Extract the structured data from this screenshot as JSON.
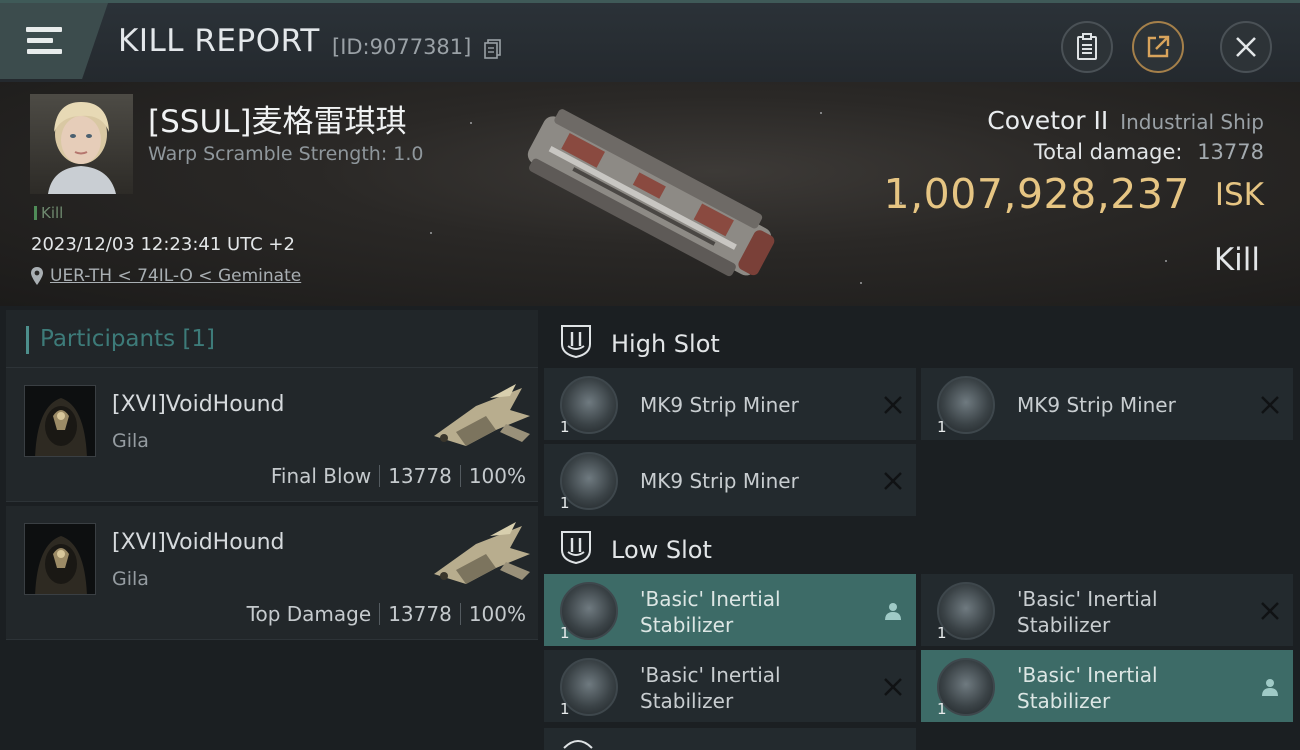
{
  "header": {
    "title": "KILL REPORT",
    "report_id": "[ID:9077381]",
    "icons": {
      "menu": "menu-icon",
      "copy": "copy-icon",
      "clipboard": "clipboard-icon",
      "share": "share-icon",
      "close": "close-icon"
    }
  },
  "victim": {
    "pilot_name": "[SSUL]麦格雷琪琪",
    "warp_scramble": "Warp Scramble Strength: 1.0",
    "kill_tag": "Kill",
    "datetime": "2023/12/03 12:23:41 UTC +2",
    "location": "UER-TH < 74IL-O < Geminate",
    "ship_name": "Covetor II",
    "ship_class": "Industrial Ship",
    "total_damage_label": "Total damage:",
    "total_damage_value": "13778",
    "isk_value": "1,007,928,237",
    "isk_unit": "ISK",
    "result_label": "Kill"
  },
  "participants": {
    "title": "Participants [1]",
    "items": [
      {
        "name": "[XVI]VoidHound",
        "ship": "Gila",
        "role": "Final Blow",
        "damage": "13778",
        "percent": "100%"
      },
      {
        "name": "[XVI]VoidHound",
        "ship": "Gila",
        "role": "Top Damage",
        "damage": "13778",
        "percent": "100%"
      }
    ]
  },
  "slots": {
    "high": {
      "label": "High Slot",
      "modules": [
        {
          "qty": "1",
          "name": "MK9 Strip Miner",
          "status": "destroyed"
        },
        {
          "qty": "1",
          "name": "MK9 Strip Miner",
          "status": "destroyed"
        },
        {
          "qty": "1",
          "name": "MK9 Strip Miner",
          "status": "destroyed"
        }
      ]
    },
    "low": {
      "label": "Low Slot",
      "modules": [
        {
          "qty": "1",
          "name": "'Basic' Inertial Stabilizer",
          "status": "dropped"
        },
        {
          "qty": "1",
          "name": "'Basic' Inertial Stabilizer",
          "status": "destroyed"
        },
        {
          "qty": "1",
          "name": "'Basic' Inertial Stabilizer",
          "status": "destroyed"
        },
        {
          "qty": "1",
          "name": "'Basic' Inertial Stabilizer",
          "status": "dropped"
        }
      ]
    }
  },
  "colors": {
    "accent_gold": "#e6c583",
    "accent_teal": "#3d6b67",
    "participants_title": "#3d7b79"
  }
}
